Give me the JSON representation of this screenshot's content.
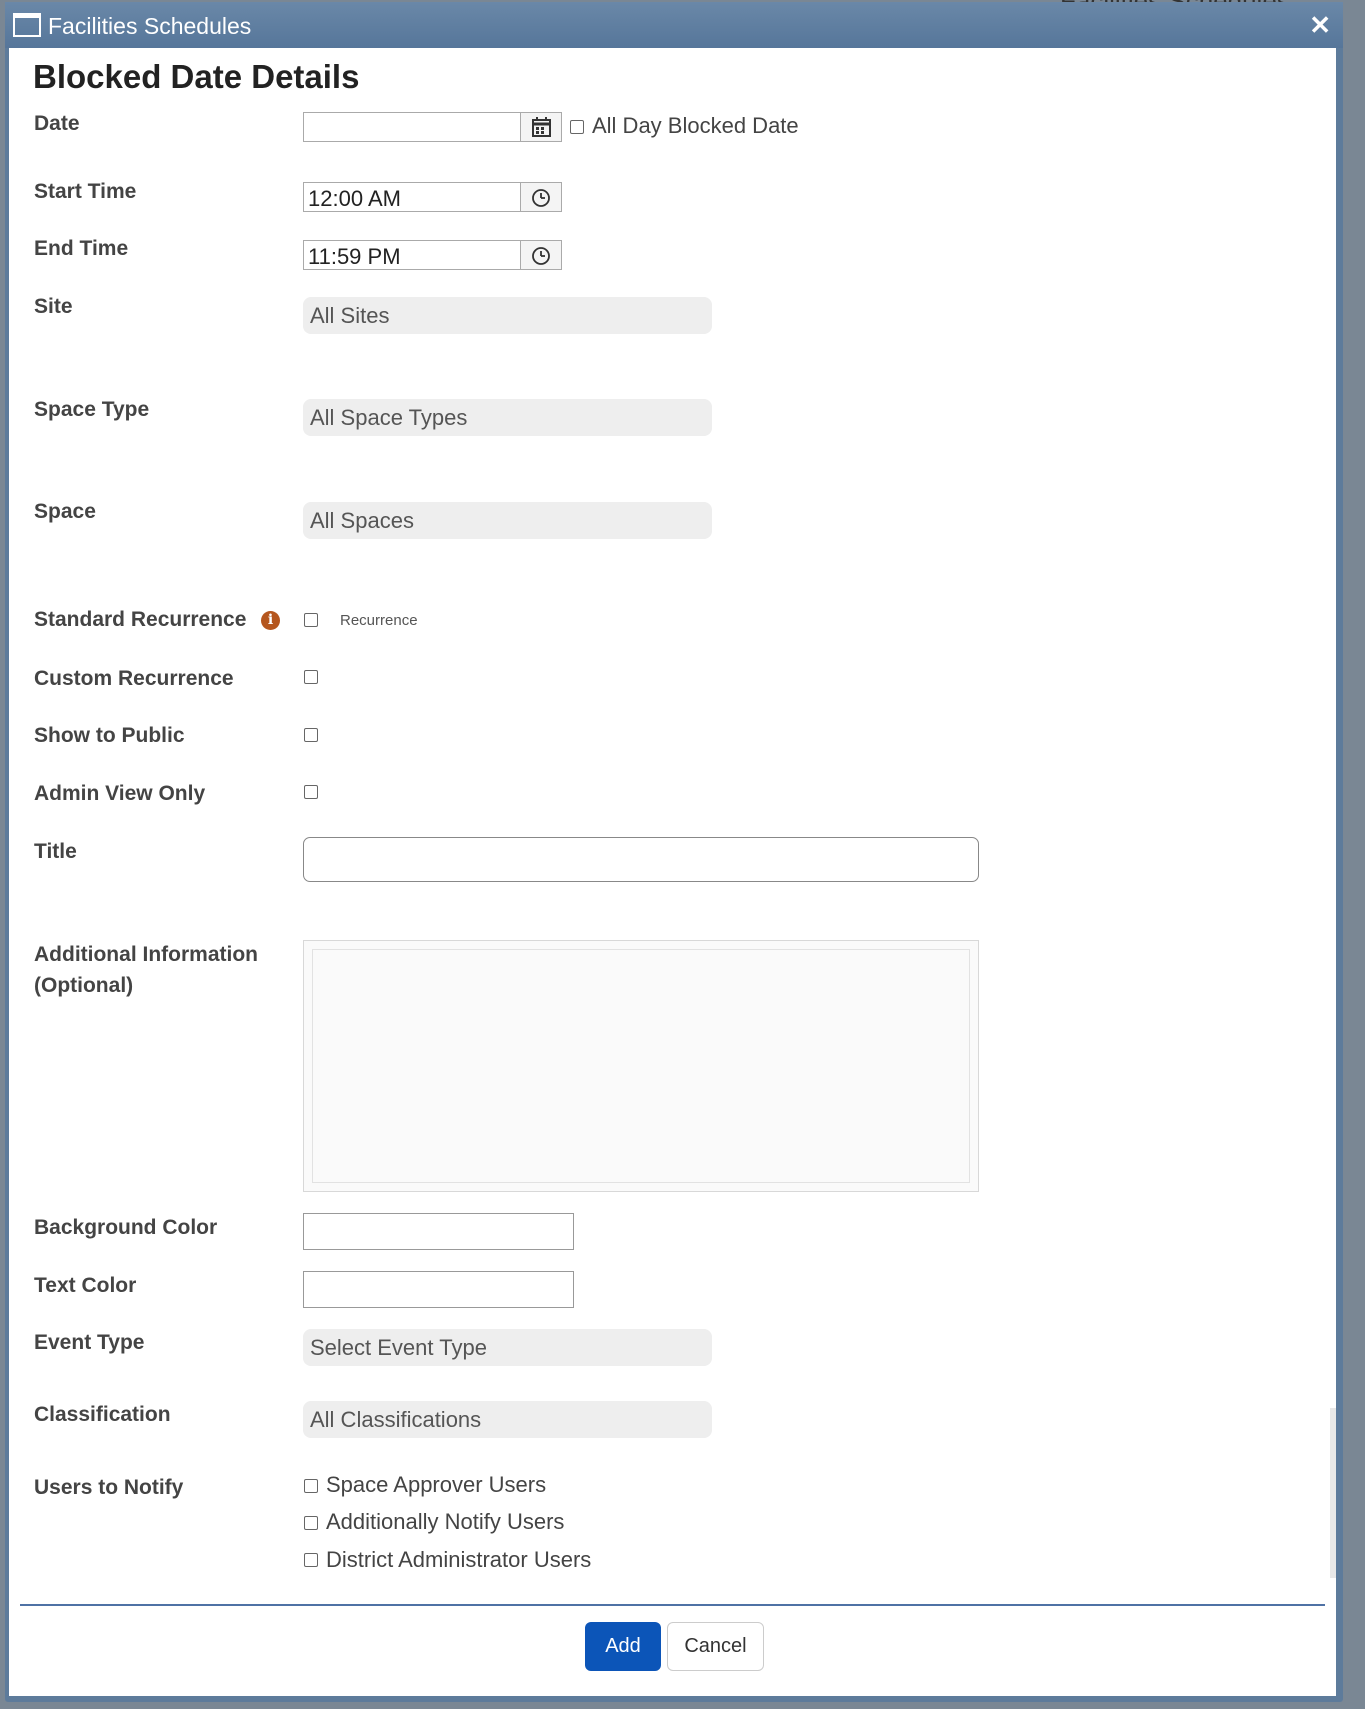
{
  "background": {
    "peek_text": "Facilities Schedules"
  },
  "window": {
    "title": "Facilities Schedules",
    "close_glyph": "✕"
  },
  "form": {
    "heading": "Blocked Date Details",
    "date": {
      "label": "Date",
      "value": "",
      "all_day_label": "All Day Blocked Date",
      "all_day_checked": false
    },
    "start_time": {
      "label": "Start Time",
      "value": "12:00 AM"
    },
    "end_time": {
      "label": "End Time",
      "value": "11:59 PM"
    },
    "site": {
      "label": "Site",
      "value": "All Sites"
    },
    "space_type": {
      "label": "Space Type",
      "value": "All Space Types"
    },
    "space": {
      "label": "Space",
      "value": "All Spaces"
    },
    "standard_recurrence": {
      "label": "Standard Recurrence",
      "checkbox_label": "Recurrence",
      "checked": false
    },
    "custom_recurrence": {
      "label": "Custom Recurrence",
      "checked": false
    },
    "show_to_public": {
      "label": "Show to Public",
      "checked": false
    },
    "admin_view_only": {
      "label": "Admin View Only",
      "checked": false
    },
    "title": {
      "label": "Title",
      "value": ""
    },
    "additional_info": {
      "label_line1": "Additional Information",
      "label_line2": "(Optional)",
      "value": ""
    },
    "background_color": {
      "label": "Background Color",
      "value": ""
    },
    "text_color": {
      "label": "Text Color",
      "value": ""
    },
    "event_type": {
      "label": "Event Type",
      "value": "Select Event Type"
    },
    "classification": {
      "label": "Classification",
      "value": "All Classifications"
    },
    "users_to_notify": {
      "label": "Users to Notify",
      "options": [
        {
          "label": "Space Approver Users",
          "checked": false
        },
        {
          "label": "Additionally Notify Users",
          "checked": false
        },
        {
          "label": "District Administrator Users",
          "checked": false
        }
      ]
    }
  },
  "buttons": {
    "add": "Add",
    "cancel": "Cancel"
  },
  "icons": {
    "calendar": "calendar-icon",
    "clock": "clock-icon",
    "info": "info-icon",
    "window": "window-icon",
    "close": "close-icon"
  },
  "colors": {
    "titlebar": "#5d7b9b",
    "primary_button": "#0c55b8",
    "divider": "#4f72a5",
    "info_icon": "#b5561e"
  }
}
